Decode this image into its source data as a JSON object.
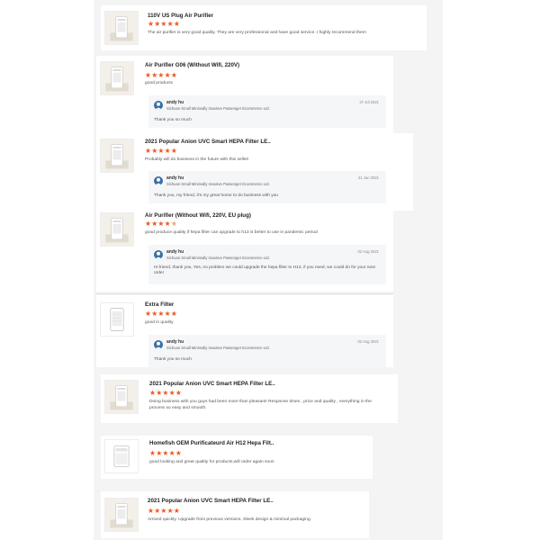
{
  "colors": {
    "star": "#ee5a24",
    "reply_bg": "#f5f6f8",
    "sheet_bg": "#f4f4f4"
  },
  "icons": {
    "star": "★",
    "thumbnail": "air-purifier-product-icon",
    "avatar": "seller-avatar-icon"
  },
  "reviews": [
    {
      "product": "110V US Plug Air Purifier",
      "rating": 5,
      "text": "The air purifier is very good quality. They are very professional and have good service. I highly recommend them"
    },
    {
      "product": "Air Purifier G06 (Without Wifi, 220V)",
      "rating": 5,
      "text": "good products",
      "reply": {
        "name": "andy hu",
        "company": "Sichuan Small Minimally Invasive Passenger Ecommerce Ltd.",
        "date": "27 Jul 2021",
        "text": "Thank you so much"
      }
    },
    {
      "product": "2021 Popular Anion UVC Smart HEPA Filter LE..",
      "rating": 5,
      "text": "Probably will do business in the future with this seller!",
      "reply": {
        "name": "andy hu",
        "company": "Sichuan Small Minimally Invasive Passenger Ecommerce Ltd.",
        "date": "21 Jun 2021",
        "text": "Thank you, my friend, it's my great honor to do business with you"
      }
    },
    {
      "product": "Air Purifier (Without Wifi, 220V, EU plug)",
      "rating": 4.5,
      "text": "good produce quality if hepa filter can upgrade to h13 is better to use in pandemic period",
      "reply": {
        "name": "andy hu",
        "company": "Sichuan Small Minimally Invasive Passenger Ecommerce Ltd.",
        "date": "02 Aug 2021",
        "text": "Hi friend, thank you, Yes, no problem we could upgrade the hepa filter to H13, if you need, we could do for your next order"
      }
    },
    {
      "product": "Extra Filter",
      "rating": 5,
      "text": "good in quality",
      "reply": {
        "name": "andy hu",
        "company": "Sichuan Small Minimally Invasive Passenger Ecommerce Ltd.",
        "date": "02 Aug 2021",
        "text": "Thank you so much"
      }
    },
    {
      "product": "2021 Popular Anion UVC Smart HEPA Filter LE..",
      "rating": 5,
      "text": "Doing business with you guys had been more than pleasant! Response times , price and quality , everything in the process so easy and smooth."
    },
    {
      "product": "Homefish OEM Purificateurd Air H12 Hepa Filt..",
      "rating": 5,
      "text": "good looking and great quality for products,will order again soon"
    },
    {
      "product": "2021 Popular Anion UVC Smart HEPA Filter LE..",
      "rating": 5,
      "text": "Arrived quickly. Upgrade from previous versions. Sleek design & minimal packaging."
    }
  ]
}
